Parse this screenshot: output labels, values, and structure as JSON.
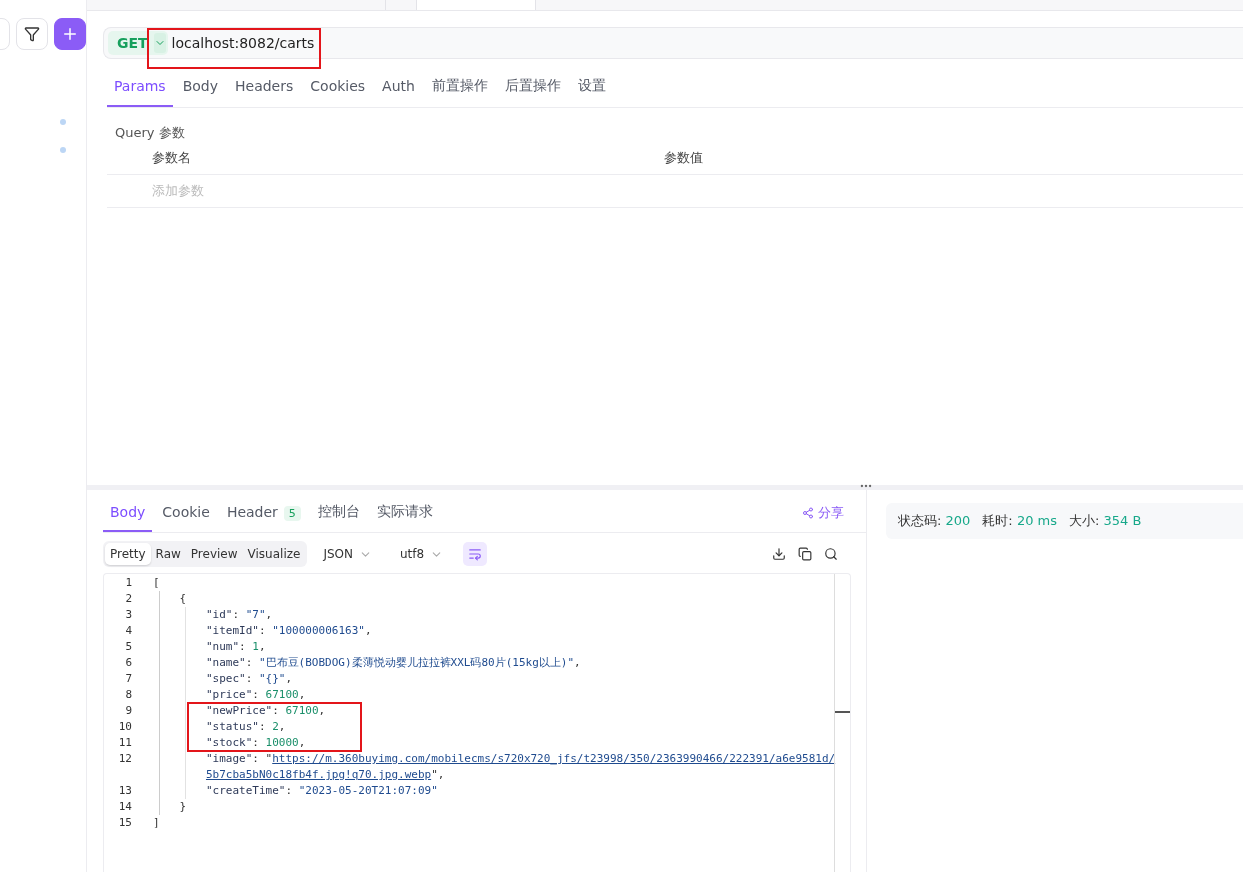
{
  "request": {
    "method": "GET",
    "url": "localhost:8082/carts"
  },
  "request_tabs": [
    {
      "label": "Params",
      "selected": true
    },
    {
      "label": "Body",
      "selected": false
    },
    {
      "label": "Headers",
      "selected": false
    },
    {
      "label": "Cookies",
      "selected": false
    },
    {
      "label": "Auth",
      "selected": false
    },
    {
      "label": "前置操作",
      "selected": false
    },
    {
      "label": "后置操作",
      "selected": false
    },
    {
      "label": "设置",
      "selected": false
    }
  ],
  "query": {
    "title": "Query 参数",
    "columns": [
      "参数名",
      "参数值"
    ],
    "add_placeholder": "添加参数"
  },
  "response_tabs": [
    {
      "label": "Body",
      "selected": true
    },
    {
      "label": "Cookie",
      "selected": false
    },
    {
      "label": "Header",
      "selected": false,
      "badge": "5"
    },
    {
      "label": "控制台",
      "selected": false
    },
    {
      "label": "实际请求",
      "selected": false
    }
  ],
  "share": "分享",
  "view_modes": [
    {
      "label": "Pretty",
      "selected": true
    },
    {
      "label": "Raw",
      "selected": false
    },
    {
      "label": "Preview",
      "selected": false
    },
    {
      "label": "Visualize",
      "selected": false
    }
  ],
  "format": "JSON",
  "encoding": "utf8",
  "wrap_on": true,
  "code_lines": [
    {
      "number": "1",
      "rows": [
        [
          {
            "kind": "punct",
            "text": "["
          }
        ]
      ]
    },
    {
      "number": "2",
      "rows": [
        [
          {
            "kind": "punct",
            "text": "    {"
          }
        ]
      ]
    },
    {
      "number": "3",
      "rows": [
        [
          {
            "kind": "key",
            "text": "        \"id\""
          },
          {
            "kind": "punct",
            "text": ": "
          },
          {
            "kind": "str",
            "text": "\"7\""
          },
          {
            "kind": "punct",
            "text": ","
          }
        ]
      ]
    },
    {
      "number": "4",
      "rows": [
        [
          {
            "kind": "key",
            "text": "        \"itemId\""
          },
          {
            "kind": "punct",
            "text": ": "
          },
          {
            "kind": "str",
            "text": "\"100000006163\""
          },
          {
            "kind": "punct",
            "text": ","
          }
        ]
      ]
    },
    {
      "number": "5",
      "rows": [
        [
          {
            "kind": "key",
            "text": "        \"num\""
          },
          {
            "kind": "punct",
            "text": ": "
          },
          {
            "kind": "num",
            "text": "1"
          },
          {
            "kind": "punct",
            "text": ","
          }
        ]
      ]
    },
    {
      "number": "6",
      "rows": [
        [
          {
            "kind": "key",
            "text": "        \"name\""
          },
          {
            "kind": "punct",
            "text": ": "
          },
          {
            "kind": "str",
            "text": "\"巴布豆(BOBDOG)柔薄悦动婴儿拉拉裤XXL码80片(15kg以上)\""
          },
          {
            "kind": "punct",
            "text": ","
          }
        ]
      ]
    },
    {
      "number": "7",
      "rows": [
        [
          {
            "kind": "key",
            "text": "        \"spec\""
          },
          {
            "kind": "punct",
            "text": ": "
          },
          {
            "kind": "str",
            "text": "\"{}\""
          },
          {
            "kind": "punct",
            "text": ","
          }
        ]
      ]
    },
    {
      "number": "8",
      "rows": [
        [
          {
            "kind": "key",
            "text": "        \"price\""
          },
          {
            "kind": "punct",
            "text": ": "
          },
          {
            "kind": "num",
            "text": "67100"
          },
          {
            "kind": "punct",
            "text": ","
          }
        ]
      ]
    },
    {
      "number": "9",
      "rows": [
        [
          {
            "kind": "key",
            "text": "        \"newPrice\""
          },
          {
            "kind": "punct",
            "text": ": "
          },
          {
            "kind": "num",
            "text": "67100"
          },
          {
            "kind": "punct",
            "text": ","
          }
        ]
      ]
    },
    {
      "number": "10",
      "rows": [
        [
          {
            "kind": "key",
            "text": "        \"status\""
          },
          {
            "kind": "punct",
            "text": ": "
          },
          {
            "kind": "num",
            "text": "2"
          },
          {
            "kind": "punct",
            "text": ","
          }
        ]
      ]
    },
    {
      "number": "11",
      "rows": [
        [
          {
            "kind": "key",
            "text": "        \"stock\""
          },
          {
            "kind": "punct",
            "text": ": "
          },
          {
            "kind": "num",
            "text": "10000"
          },
          {
            "kind": "punct",
            "text": ","
          }
        ]
      ]
    },
    {
      "number": "12",
      "rows": [
        [
          {
            "kind": "key",
            "text": "        \"image\""
          },
          {
            "kind": "punct",
            "text": ": \""
          },
          {
            "kind": "link",
            "text": "https://m.360buyimg.com/mobilecms/s720x720_jfs/t23998/350/2363990466/222391/a6e9581d/5b7cba5bN0c18fb4f.jpg!q70.jpg.webp"
          },
          {
            "kind": "punct",
            "text": "\","
          }
        ]
      ]
    },
    {
      "number": "13",
      "rows": [
        [
          {
            "kind": "key",
            "text": "        \"createTime\""
          },
          {
            "kind": "punct",
            "text": ": "
          },
          {
            "kind": "str",
            "text": "\"2023-05-20T21:07:09\""
          }
        ]
      ]
    },
    {
      "number": "14",
      "rows": [
        [
          {
            "kind": "punct",
            "text": "    }"
          }
        ]
      ]
    },
    {
      "number": "15",
      "rows": [
        [
          {
            "kind": "punct",
            "text": "]"
          }
        ]
      ]
    }
  ],
  "status": [
    {
      "label": "状态码:",
      "value": "200"
    },
    {
      "label": "耗时:",
      "value": "20 ms"
    },
    {
      "label": "大小:",
      "value": "354 B"
    }
  ]
}
